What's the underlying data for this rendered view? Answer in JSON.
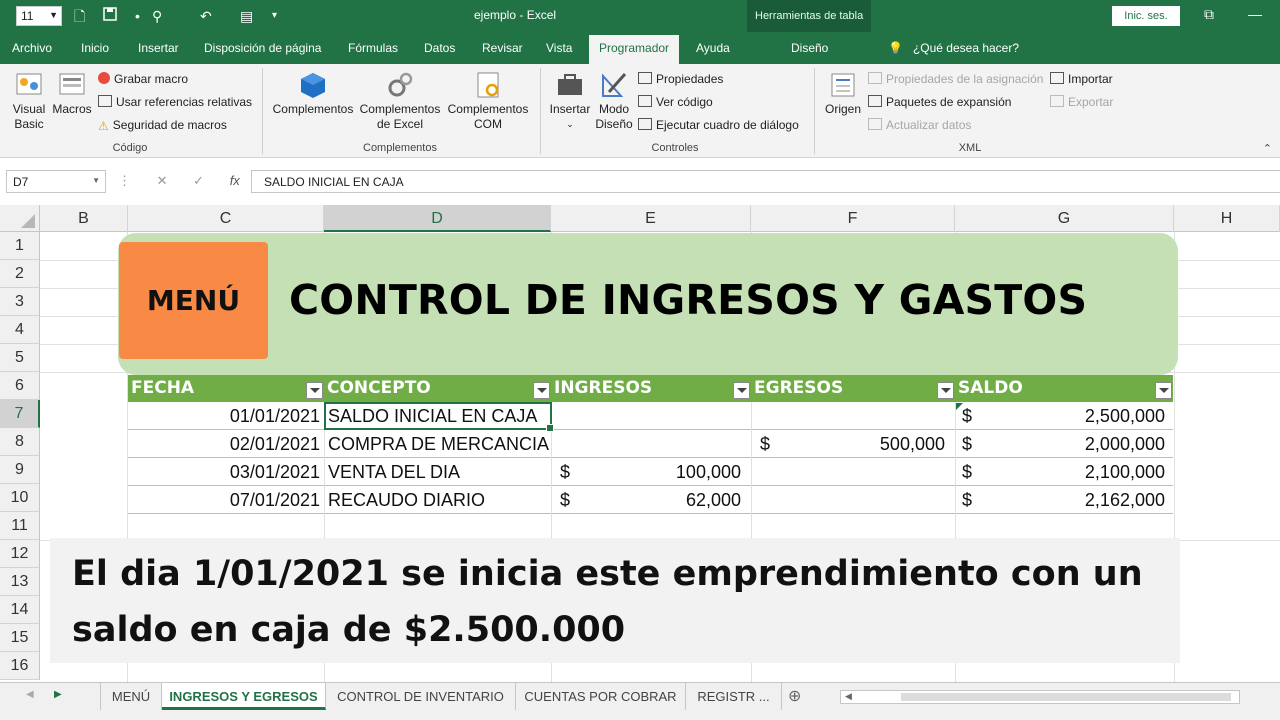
{
  "titlebar": {
    "font_size_value": "11",
    "title": "ejemplo  -  Excel",
    "herramientas": "Herramientas de tabla",
    "signin": "Inic. ses."
  },
  "tabs": [
    "Archivo",
    "Inicio",
    "Insertar",
    "Disposición de página",
    "Fórmulas",
    "Datos",
    "Revisar",
    "Vista",
    "Programador",
    "Ayuda",
    "Diseño"
  ],
  "tellme": "¿Qué desea hacer?",
  "ribbon": {
    "codigo": {
      "visual_basic": "Visual Basic",
      "macros": "Macros",
      "grabar": "Grabar macro",
      "usar_ref": "Usar referencias relativas",
      "seguridad": "Seguridad de macros",
      "group": "Código"
    },
    "complementos": {
      "complementos": "Complementos",
      "excel": "Complementos de Excel",
      "com": "Complementos COM",
      "group": "Complementos"
    },
    "controles": {
      "insertar": "Insertar",
      "modo": "Modo Diseño",
      "propiedades": "Propiedades",
      "ver_codigo": "Ver código",
      "ejecutar": "Ejecutar cuadro de diálogo",
      "group": "Controles"
    },
    "xml": {
      "origen": "Origen",
      "prop_asig": "Propiedades de la asignación",
      "paquetes": "Paquetes de expansión",
      "actualizar": "Actualizar datos",
      "importar": "Importar",
      "exportar": "Exportar",
      "group": "XML"
    }
  },
  "formula_bar": {
    "name_box": "D7",
    "formula": "SALDO INICIAL EN CAJA"
  },
  "columns": [
    "B",
    "C",
    "D",
    "E",
    "F",
    "G",
    "H"
  ],
  "rows": [
    "1",
    "2",
    "3",
    "4",
    "5",
    "6",
    "7",
    "8",
    "9",
    "10",
    "11",
    "12",
    "13",
    "14",
    "15",
    "16"
  ],
  "banner": {
    "menu_label": "MENÚ",
    "title": "CONTROL DE INGRESOS Y GASTOS"
  },
  "table": {
    "headers": [
      "FECHA",
      "CONCEPTO",
      "INGRESOS",
      "EGRESOS",
      "SALDO"
    ],
    "rows": [
      {
        "fecha": "01/01/2021",
        "concepto": "SALDO INICIAL EN CAJA",
        "ingresos": "",
        "egresos": "",
        "saldo": "2,500,000"
      },
      {
        "fecha": "02/01/2021",
        "concepto": "COMPRA DE MERCANCIA",
        "ingresos": "",
        "egresos": "500,000",
        "saldo": "2,000,000"
      },
      {
        "fecha": "03/01/2021",
        "concepto": "VENTA DEL DIA",
        "ingresos": "100,000",
        "egresos": "",
        "saldo": "2,100,000"
      },
      {
        "fecha": "07/01/2021",
        "concepto": "RECAUDO DIARIO",
        "ingresos": "62,000",
        "egresos": "",
        "saldo": "2,162,000"
      }
    ],
    "currency": "$"
  },
  "caption": "El dia 1/01/2021  se inicia este emprendimiento con un saldo en caja de $2.500.000",
  "sheet_tabs": [
    "MENÚ",
    "INGRESOS Y EGRESOS",
    "CONTROL DE INVENTARIO",
    "CUENTAS POR COBRAR",
    "REGISTR ..."
  ],
  "colors": {
    "excel_green": "#217346",
    "table_header": "#70ad47",
    "banner": "#c5e0b4",
    "menu_button": "#f88a45"
  }
}
